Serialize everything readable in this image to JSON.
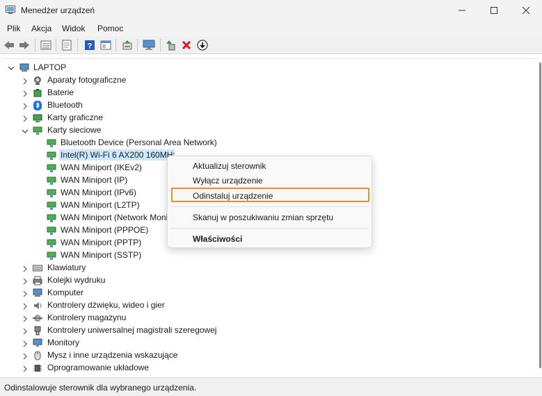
{
  "window": {
    "title": "Menedżer urządzeń"
  },
  "menu": [
    "Plik",
    "Akcja",
    "Widok",
    "Pomoc"
  ],
  "toolbar": {
    "buttons": [
      "back-icon",
      "forward-icon",
      "properties-list-icon",
      "details-icon",
      "help-icon",
      "view-icon",
      "driver-update-icon",
      "monitor-icon",
      "add-driver-icon",
      "uninstall-icon",
      "download-icon"
    ],
    "colors": {
      "uninstall": "#e0141e"
    }
  },
  "tree": {
    "root": "LAPTOP",
    "categories_top": [
      {
        "label": "Aparaty fotograficzne",
        "icon": "camera-icon"
      },
      {
        "label": "Baterie",
        "icon": "battery-icon"
      },
      {
        "label": "Bluetooth",
        "icon": "bluetooth-icon"
      },
      {
        "label": "Karty graficzne",
        "icon": "display-adapter-icon"
      }
    ],
    "expanded": {
      "label": "Karty sieciowe",
      "icon": "network-adapter-icon"
    },
    "children": [
      "Bluetooth Device (Personal Area Network)",
      "Intel(R) Wi-Fi 6 AX200 160MHz",
      "WAN Miniport (IKEv2)",
      "WAN Miniport (IP)",
      "WAN Miniport (IPv6)",
      "WAN Miniport (L2TP)",
      "WAN Miniport (Network Monitor)",
      "WAN Miniport (PPPOE)",
      "WAN Miniport (PPTP)",
      "WAN Miniport (SSTP)"
    ],
    "categories_bottom": [
      {
        "label": "Klawiatury",
        "icon": "keyboard-icon"
      },
      {
        "label": "Kolejki wydruku",
        "icon": "printer-icon"
      },
      {
        "label": "Komputer",
        "icon": "computer-icon"
      },
      {
        "label": "Kontrolery dźwięku, wideo i gier",
        "icon": "speaker-icon"
      },
      {
        "label": "Kontrolery magazynu",
        "icon": "storage-controller-icon"
      },
      {
        "label": "Kontrolery uniwersalnej magistrali szeregowej",
        "icon": "usb-icon"
      },
      {
        "label": "Monitory",
        "icon": "monitor-icon"
      },
      {
        "label": "Mysz i inne urządzenia wskazujące",
        "icon": "mouse-icon"
      },
      {
        "label": "Oprogramowanie układowe",
        "icon": "firmware-icon"
      }
    ]
  },
  "context_menu": {
    "items": [
      "Aktualizuj sterownik",
      "Wyłącz urządzenie",
      "Odinstaluj urządzenie",
      "Skanuj w poszukiwaniu zmian sprzętu",
      "Właściwości"
    ],
    "highlight_color": "#f08a24"
  },
  "status": {
    "text": "Odinstalowuje sterownik dla wybranego urządzenia."
  }
}
